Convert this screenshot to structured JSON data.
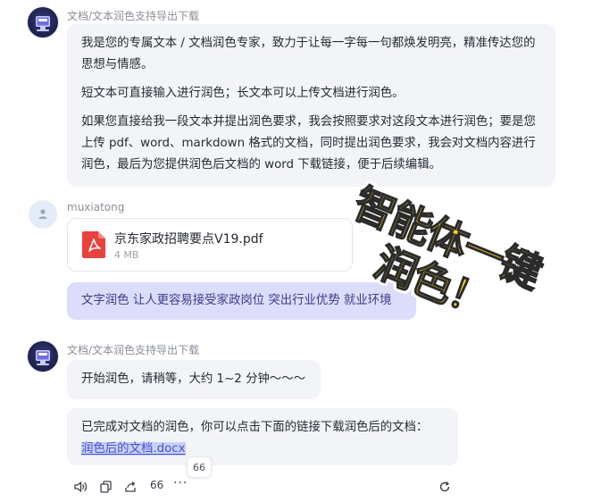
{
  "messages": {
    "bot1": {
      "sender": "文档/文本润色支持导出下载",
      "paragraphs": [
        "我是您的专属文本 / 文档润色专家，致力于让每一字每一句都焕发明亮，精准传达您的思想与情感。",
        "短文本可直接输入进行润色；长文本可以上传文档进行润色。",
        "如果您直接给我一段文本并提出润色要求，我会按照要求对这段文本进行润色；要是您上传 pdf、word、markdown 格式的文档，同时提出润色要求，我会对文档内容进行润色，最后为您提供润色后文档的 word 下载链接，便于后续编辑。"
      ]
    },
    "user": {
      "sender": "muxiatong",
      "file": {
        "name": "京东家政招聘要点V19.pdf",
        "size": "4 MB",
        "icon": "pdf-file-icon"
      },
      "text": "文字润色 让人更容易接受家政岗位 突出行业优势 就业环境"
    },
    "bot2": {
      "sender": "文档/文本润色支持导出下载",
      "status": "开始润色，请稍等，大约 1~2 分钟～～～",
      "result_text": "已完成对文档的润色，你可以点击下面的链接下载润色后的文档：",
      "link_label": "润色后的文档.docx"
    }
  },
  "tooltip": "66",
  "actions": {
    "count": "66",
    "more": "···",
    "icons": [
      "speaker-icon",
      "copy-icon",
      "share-icon",
      "more-icon",
      "refresh-icon"
    ]
  },
  "overlay": {
    "line1": "智能体一键",
    "line2": "润色！",
    "fill_color": "#ffd426",
    "stroke_color": "#2b2b2b"
  },
  "colors": {
    "user_bubble": "#dcdcfb",
    "bot_bubble": "#f3f4f7",
    "link": "#4b4ed9",
    "pdf_red": "#e8423f"
  }
}
